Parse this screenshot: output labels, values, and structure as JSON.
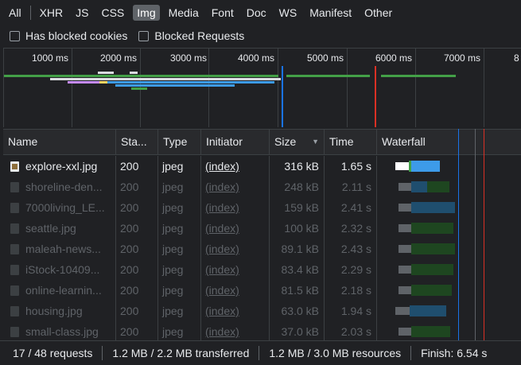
{
  "filters": {
    "items": [
      "All",
      "XHR",
      "JS",
      "CSS",
      "Img",
      "Media",
      "Font",
      "Doc",
      "WS",
      "Manifest",
      "Other"
    ],
    "selected": "Img"
  },
  "options": {
    "has_blocked_cookies": "Has blocked cookies",
    "blocked_requests": "Blocked Requests"
  },
  "overview": {
    "ticks": [
      "1000 ms",
      "2000 ms",
      "3000 ms",
      "4000 ms",
      "5000 ms",
      "6000 ms",
      "7000 ms",
      "8"
    ]
  },
  "table": {
    "headers": {
      "name": "Name",
      "status": "Sta...",
      "type": "Type",
      "initiator": "Initiator",
      "size": "Size",
      "time": "Time",
      "waterfall": "Waterfall"
    },
    "sort_icon": "sort-down-icon",
    "rows": [
      {
        "name": "explore-xxl.jpg",
        "status": "200",
        "type": "jpeg",
        "initiator": "(index)",
        "size": "316 kB",
        "time": "1.65 s"
      },
      {
        "name": "shoreline-den...",
        "status": "200",
        "type": "jpeg",
        "initiator": "(index)",
        "size": "248 kB",
        "time": "2.11 s"
      },
      {
        "name": "7000living_LE...",
        "status": "200",
        "type": "jpeg",
        "initiator": "(index)",
        "size": "159 kB",
        "time": "2.41 s"
      },
      {
        "name": "seattle.jpg",
        "status": "200",
        "type": "jpeg",
        "initiator": "(index)",
        "size": "100 kB",
        "time": "2.32 s"
      },
      {
        "name": "maleah-news...",
        "status": "200",
        "type": "jpeg",
        "initiator": "(index)",
        "size": "89.1 kB",
        "time": "2.43 s"
      },
      {
        "name": "iStock-10409...",
        "status": "200",
        "type": "jpeg",
        "initiator": "(index)",
        "size": "83.4 kB",
        "time": "2.29 s"
      },
      {
        "name": "online-learnin...",
        "status": "200",
        "type": "jpeg",
        "initiator": "(index)",
        "size": "81.5 kB",
        "time": "2.18 s"
      },
      {
        "name": "housing.jpg",
        "status": "200",
        "type": "jpeg",
        "initiator": "(index)",
        "size": "63.0 kB",
        "time": "1.94 s"
      },
      {
        "name": "small-class.jpg",
        "status": "200",
        "type": "jpeg",
        "initiator": "(index)",
        "size": "37.0 kB",
        "time": "2.03 s"
      }
    ]
  },
  "statusbar": {
    "requests": "17 / 48 requests",
    "transferred": "1.2 MB / 2.2 MB transferred",
    "resources": "1.2 MB / 3.0 MB resources",
    "finish": "Finish: 6.54 s"
  },
  "colors": {
    "selected_filter_bg": "#5f6368",
    "download_blue": "#3d9be9",
    "waiting_green": "#2e7d32",
    "dom_content_loaded": "#1a73e8",
    "load_event": "#d93025"
  }
}
